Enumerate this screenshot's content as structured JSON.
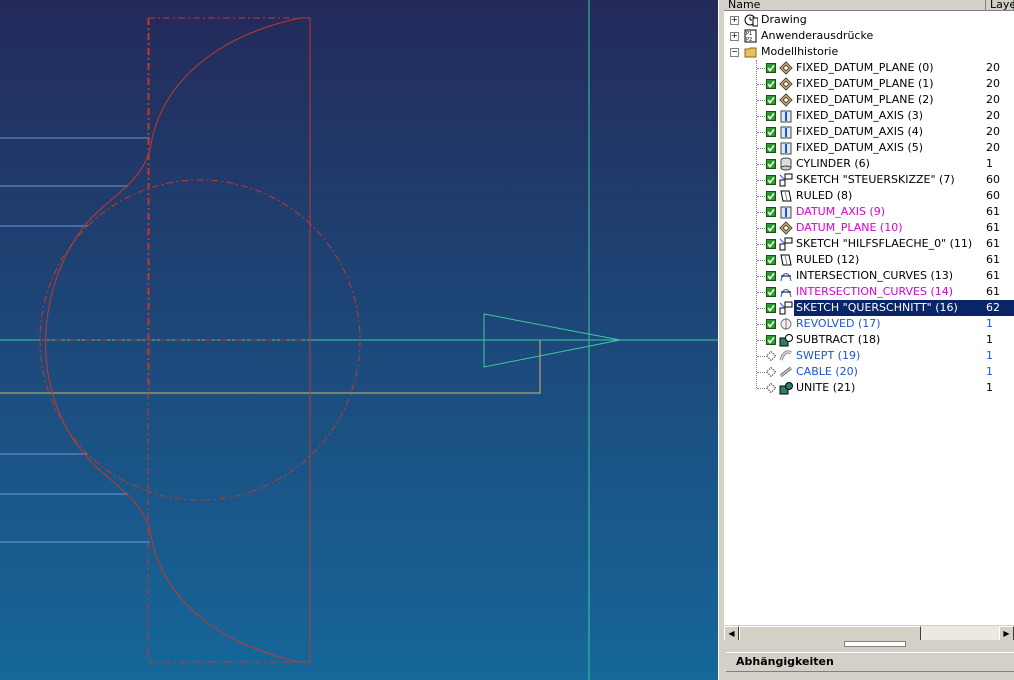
{
  "navigator": {
    "columns": {
      "name": "Name",
      "layer": "Laye"
    },
    "top_nodes": [
      {
        "label": "Drawing",
        "icon": "drawing-clock-icon",
        "expanded": false
      },
      {
        "label": "Anwenderausdrücke",
        "icon": "expressions-icon",
        "expanded": false
      },
      {
        "label": "Modellhistorie",
        "icon": "folder-open-icon",
        "expanded": true
      }
    ],
    "features": [
      {
        "label": "FIXED_DATUM_PLANE (0)",
        "layer": "20",
        "icon": "datum-plane-icon",
        "checked": true,
        "style": "normal"
      },
      {
        "label": "FIXED_DATUM_PLANE (1)",
        "layer": "20",
        "icon": "datum-plane-icon",
        "checked": true,
        "style": "normal"
      },
      {
        "label": "FIXED_DATUM_PLANE (2)",
        "layer": "20",
        "icon": "datum-plane-icon",
        "checked": true,
        "style": "normal"
      },
      {
        "label": "FIXED_DATUM_AXIS (3)",
        "layer": "20",
        "icon": "datum-axis-icon",
        "checked": true,
        "style": "normal"
      },
      {
        "label": "FIXED_DATUM_AXIS (4)",
        "layer": "20",
        "icon": "datum-axis-icon",
        "checked": true,
        "style": "normal"
      },
      {
        "label": "FIXED_DATUM_AXIS (5)",
        "layer": "20",
        "icon": "datum-axis-icon",
        "checked": true,
        "style": "normal"
      },
      {
        "label": "CYLINDER (6)",
        "layer": "1",
        "icon": "cylinder-icon",
        "checked": true,
        "style": "normal"
      },
      {
        "label": "SKETCH \"STEUERSKIZZE\" (7)",
        "layer": "60",
        "icon": "sketch-icon",
        "checked": true,
        "style": "normal"
      },
      {
        "label": "RULED (8)",
        "layer": "60",
        "icon": "ruled-icon",
        "checked": true,
        "style": "normal"
      },
      {
        "label": "DATUM_AXIS (9)",
        "layer": "61",
        "icon": "datum-axis-icon",
        "checked": true,
        "style": "magenta"
      },
      {
        "label": "DATUM_PLANE (10)",
        "layer": "61",
        "icon": "datum-plane-icon",
        "checked": true,
        "style": "magenta"
      },
      {
        "label": "SKETCH \"HILFSFLAECHE_0\" (11)",
        "layer": "61",
        "icon": "sketch-icon",
        "checked": true,
        "style": "normal"
      },
      {
        "label": "RULED (12)",
        "layer": "61",
        "icon": "ruled-icon",
        "checked": true,
        "style": "normal"
      },
      {
        "label": "INTERSECTION_CURVES (13)",
        "layer": "61",
        "icon": "intersection-curves-icon",
        "checked": true,
        "style": "normal"
      },
      {
        "label": "INTERSECTION_CURVES (14)",
        "layer": "61",
        "icon": "intersection-curves-icon",
        "checked": true,
        "style": "magenta"
      },
      {
        "label": "SKETCH \"QUERSCHNITT\" (16)",
        "layer": "62",
        "icon": "sketch-icon",
        "checked": true,
        "style": "selected"
      },
      {
        "label": "REVOLVED (17)",
        "layer": "1",
        "icon": "revolved-icon",
        "checked": true,
        "style": "blue"
      },
      {
        "label": "SUBTRACT (18)",
        "layer": "1",
        "icon": "subtract-icon",
        "checked": true,
        "style": "normal"
      },
      {
        "label": "SWEPT (19)",
        "layer": "1",
        "icon": "swept-icon",
        "checked": false,
        "style": "blue"
      },
      {
        "label": "CABLE (20)",
        "layer": "1",
        "icon": "cable-icon",
        "checked": false,
        "style": "blue"
      },
      {
        "label": "UNITE (21)",
        "layer": "1",
        "icon": "unite-icon",
        "checked": false,
        "style": "normal"
      }
    ],
    "dependencies_label": "Abhängigkeiten"
  },
  "colors": {
    "viewport_top": "#232a5a",
    "viewport_bottom": "#16679a",
    "sketch_red": "#c0392b",
    "datum_green": "#3cc8a0",
    "axis_blue": "#6b9ad8",
    "path_yellow": "#d9b56a",
    "selection": "#0a246a",
    "magenta_text": "#d400d4",
    "blue_text": "#1d55d6",
    "check_green": "#2f9a2f"
  }
}
